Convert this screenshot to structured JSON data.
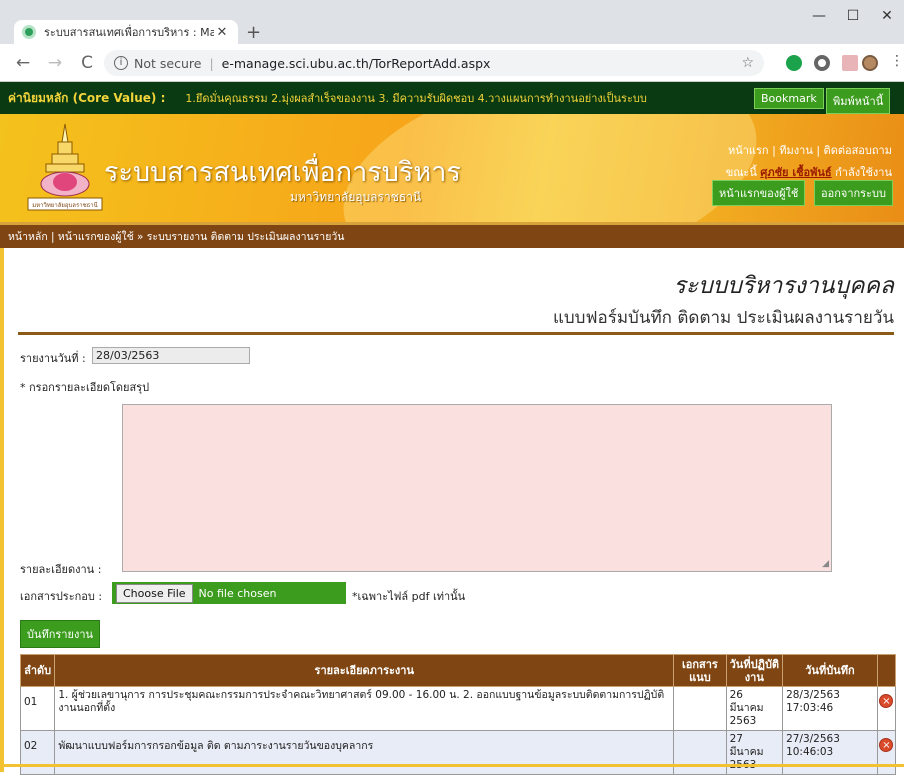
{
  "browser": {
    "tab_title": "ระบบสารสนเทศเพื่อการบริหาร : Mana",
    "tab_close": "✕",
    "new_tab": "+",
    "minimize": "—",
    "maximize": "☐",
    "close": "✕",
    "back": "←",
    "forward": "→",
    "reload": "C",
    "info": "i",
    "not_secure": "Not secure",
    "separator": "|",
    "url": "e-manage.sci.ubu.ac.th/TorReportAdd.aspx",
    "star": "☆",
    "menu": "⋮"
  },
  "corebar": {
    "label": "ค่านิยมหลัก (Core Value) :",
    "text": "1.ยึดมั่นคุณธรรม 2.มุ่งผลสำเร็จของงาน 3. มีความรับผิดชอบ 4.วางแผนการทำงานอย่างเป็นระบบ",
    "bookmark": "Bookmark",
    "print": "พิมพ์หน้านี้"
  },
  "header": {
    "title": "ระบบสารสนเทศเพื่อการบริหาร",
    "subtitle": "มหาวิทยาลัยอุบลราชธานี",
    "logo_text": "มหาวิทยาลัยอุบลราชธานี",
    "links": "หน้าแรก | ทีมงาน | ติดต่อสอบถาม",
    "user_prefix": "ขณะนี้ ",
    "user_name": "ศุภชัย เชื้อพันธ์",
    "user_suffix": " กำลังใช้งาน",
    "home_btn": "หน้าแรกของผู้ใช้",
    "logout_btn": "ออกจากระบบ"
  },
  "breadcrumb": "หน้าหลัก | หน้าแรกของผู้ใช้ » ระบบรายงาน ติดตาม ประเมินผลงานรายวัน",
  "form": {
    "heading1": "ระบบบริหารงานบุคคล",
    "heading2": "แบบฟอร์มบันทึก ติดตาม ประเมินผลงานรายวัน",
    "date_label": "รายงานวันที่ :",
    "date_value": "28/03/2563",
    "hint": "* กรอกรายละเอียดโดยสรุป",
    "detail_label": "รายละเอียดงาน    :",
    "attach_label": "เอกสารประกอบ :",
    "choose_file": "Choose File",
    "no_file": "No file chosen",
    "pdf_note": "*เฉพาะไฟล์ pdf เท่านั้น",
    "save_btn": "บันทึกรายงาน"
  },
  "table": {
    "headers": [
      "ลำดับ",
      "รายละเอียดภาระงาน",
      "เอกสารแนบ",
      "วันที่ปฏิบัติงาน",
      "วันที่บันทึก",
      ""
    ],
    "rows": [
      {
        "no": "01",
        "detail": "1. ผู้ช่วยเลขานุการ การประชุมคณะกรรมการประจำคณะวิทยาศาสตร์ 09.00 - 16.00 น. 2. ออกแบบฐานข้อมูลระบบติดตามการปฏิบัติงานนอกที่ตั้ง",
        "attach": "",
        "work_date": "26 มีนาคม 2563",
        "record_date": "28/3/2563 17:03:46",
        "delete": "×"
      },
      {
        "no": "02",
        "detail": "พัฒนาแบบฟอร์มการกรอกข้อมูล ติด ตามภาระงานรายวันของบุคลากร",
        "attach": "",
        "work_date": "27 มีนาคม 2563",
        "record_date": "27/3/2563 10:46:03",
        "delete": "×"
      }
    ]
  }
}
